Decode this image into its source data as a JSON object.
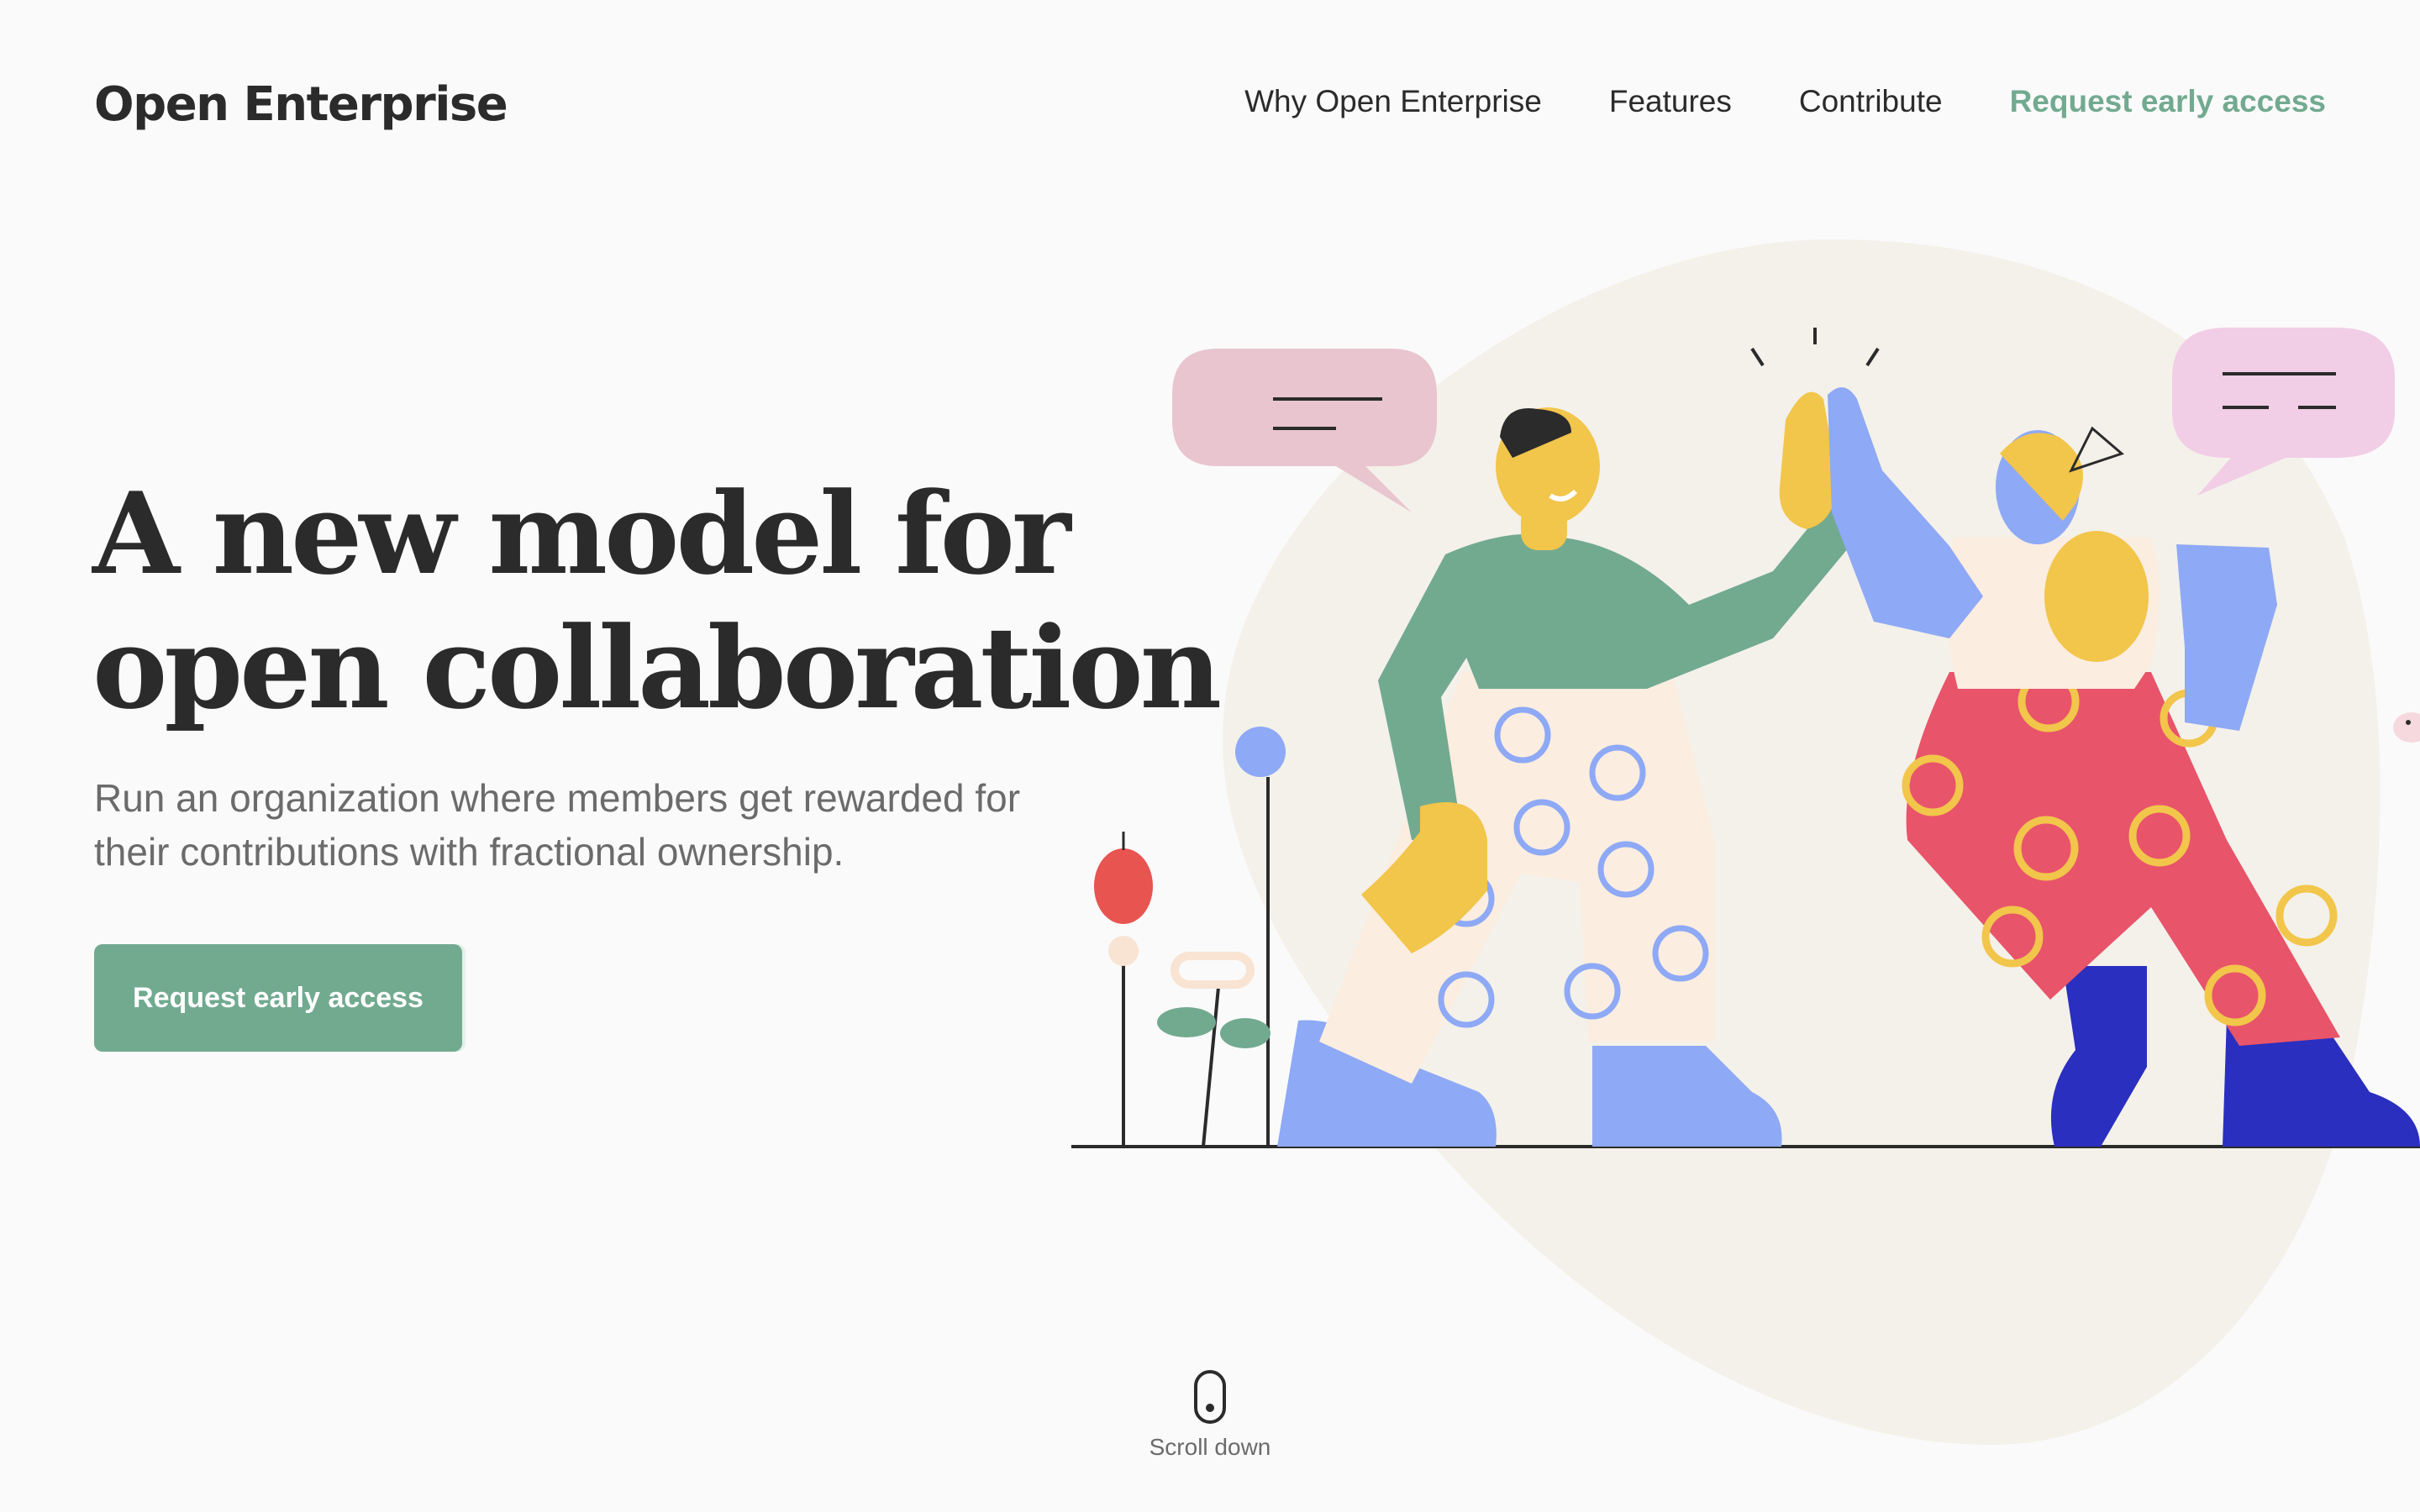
{
  "header": {
    "logo": "Open Enterprise",
    "nav": [
      {
        "label": "Why Open Enterprise"
      },
      {
        "label": "Features"
      },
      {
        "label": "Contribute"
      },
      {
        "label": "Request early access"
      }
    ]
  },
  "hero": {
    "headline_line1": "A new model for",
    "headline_line2": "open collaboration",
    "subtitle_line1": "Run an organization where members get rewarded for",
    "subtitle_line2": "their contributions with fractional ownership.",
    "cta_label": "Request early access"
  },
  "scroll": {
    "label": "Scroll down",
    "icon": "mouse-icon"
  },
  "colors": {
    "accent": "#72aa90",
    "text": "#2b2b2b",
    "muted": "#6b6b6b",
    "background": "#fafafa",
    "blob": "#f4f1ea"
  }
}
